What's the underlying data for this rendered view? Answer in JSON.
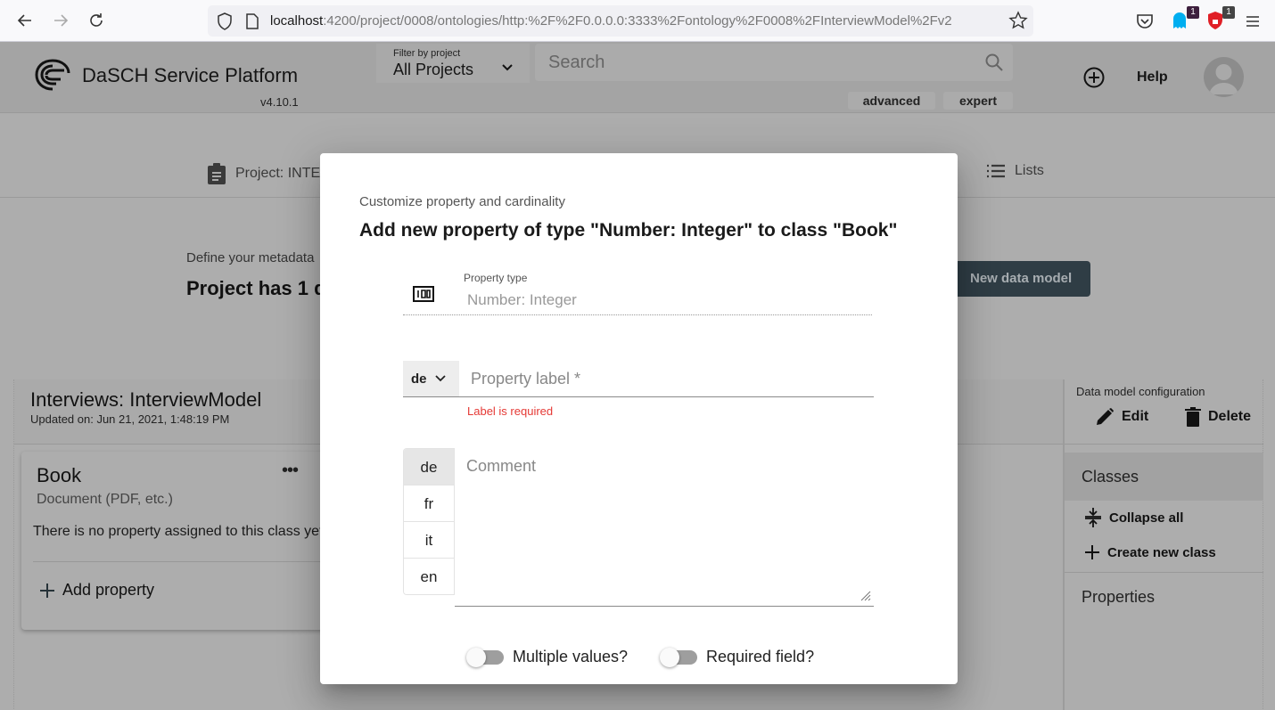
{
  "browser": {
    "url_host": "localhost",
    "url_rest": ":4200/project/0008/ontologies/http:%2F%2F0.0.0.0:3333%2Fontology%2F0008%2FInterviewModel%2Fv2",
    "ext_badge_1": "1",
    "ext_badge_2": "1",
    "colors": {
      "ghostery": "#00aef0",
      "ublock": "#e01f26",
      "badge1_bg": "#3d1f3d",
      "badge2_bg": "#444444"
    }
  },
  "header": {
    "app_title": "DaSCH Service Platform",
    "version": "v4.10.1",
    "filter_label": "Filter by project",
    "filter_value": "All Projects",
    "search_placeholder": "Search",
    "advanced_label": "advanced",
    "expert_label": "expert",
    "help_label": "Help"
  },
  "tabs": {
    "project_label": "Project: INTE",
    "lists_label": "Lists"
  },
  "page": {
    "define_text": "Define your metadata",
    "project_count_text": "Project has 1 d",
    "new_model_button": "New data model"
  },
  "model": {
    "title": "Interviews: InterviewModel",
    "updated": "Updated on: Jun 21, 2021, 1:48:19 PM",
    "class": {
      "name": "Book",
      "type": "Document (PDF, etc.)",
      "more": "•••",
      "empty_text": "There is no property assigned to this class yet.",
      "add_property": "Add property"
    }
  },
  "config": {
    "label": "Data model configuration",
    "edit": "Edit",
    "delete": "Delete",
    "classes_header": "Classes",
    "collapse_all": "Collapse all",
    "create_class": "Create new class",
    "properties_header": "Properties"
  },
  "dialog": {
    "subtitle": "Customize property and cardinality",
    "title": "Add new property of type \"Number: Integer\" to class \"Book\"",
    "property_type_label": "Property type",
    "property_type_value": "Number: Integer",
    "label_lang": "de",
    "label_placeholder": "Property label *",
    "label_error": "Label is required",
    "comment_placeholder": "Comment",
    "comment_langs": [
      "de",
      "fr",
      "it",
      "en"
    ],
    "active_comment_lang": "de",
    "multiple_values_label": "Multiple values?",
    "multiple_values_on": false,
    "required_field_label": "Required field?",
    "required_field_on": false,
    "error_color": "#e53935"
  }
}
